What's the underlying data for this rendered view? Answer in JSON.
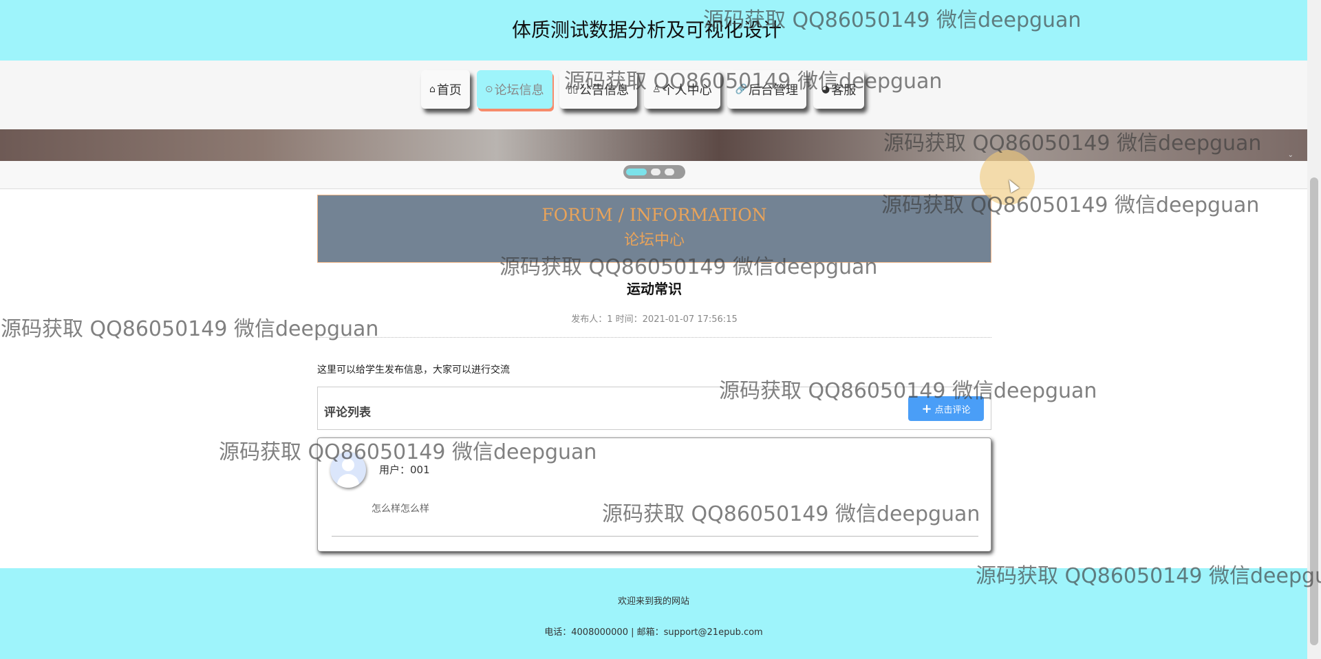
{
  "site": {
    "title": "体质测试数据分析及可视化设计"
  },
  "nav": {
    "items": [
      {
        "icon": "⌂",
        "label": "首页"
      },
      {
        "icon": "⊙",
        "label": "论坛信息"
      },
      {
        "icon": "▯▯",
        "label": "公告信息"
      },
      {
        "icon": "♙",
        "label": "个人中心"
      },
      {
        "icon": "🔗",
        "label": "后台管理"
      },
      {
        "icon": "◕",
        "label": "客服"
      }
    ],
    "active_index": 1
  },
  "banner": {
    "slides": 3,
    "active_slide": 1,
    "arrow": "⌄"
  },
  "section": {
    "title_en": "FORUM / INFORMATION",
    "title_cn": "论坛中心"
  },
  "post": {
    "title": "运动常识",
    "meta": "发布人：1 时间：2021-01-07 17:56:15",
    "content": "这里可以给学生发布信息，大家可以进行交流"
  },
  "comments": {
    "header": "评论列表",
    "add_button": "点击评论",
    "add_icon": "+",
    "items": [
      {
        "user": "用户：001",
        "text": "怎么样怎么样"
      }
    ]
  },
  "footer": {
    "welcome": "欢迎来到我的网站",
    "contact": "电话：4008000000 | 邮箱：support@21epub.com"
  },
  "watermarks": [
    "源码获取 QQ86050149 微信deepguan",
    "源码获取 QQ86050149 微信deepguan",
    "源码获取 QQ86050149 微信deepguan",
    "源码获取 QQ86050149 微信deepguan",
    "源码获取 QQ86050149 微信deepguan",
    "源码获取 QQ86050149 微信deepguan",
    "源码获取 QQ86050149 微信deepguan",
    "源码获取 QQ86050149 微信deepguan",
    "源码获取 QQ86050149 微信deepguan",
    "源码获取 QQ86050149 微信deepgu"
  ]
}
